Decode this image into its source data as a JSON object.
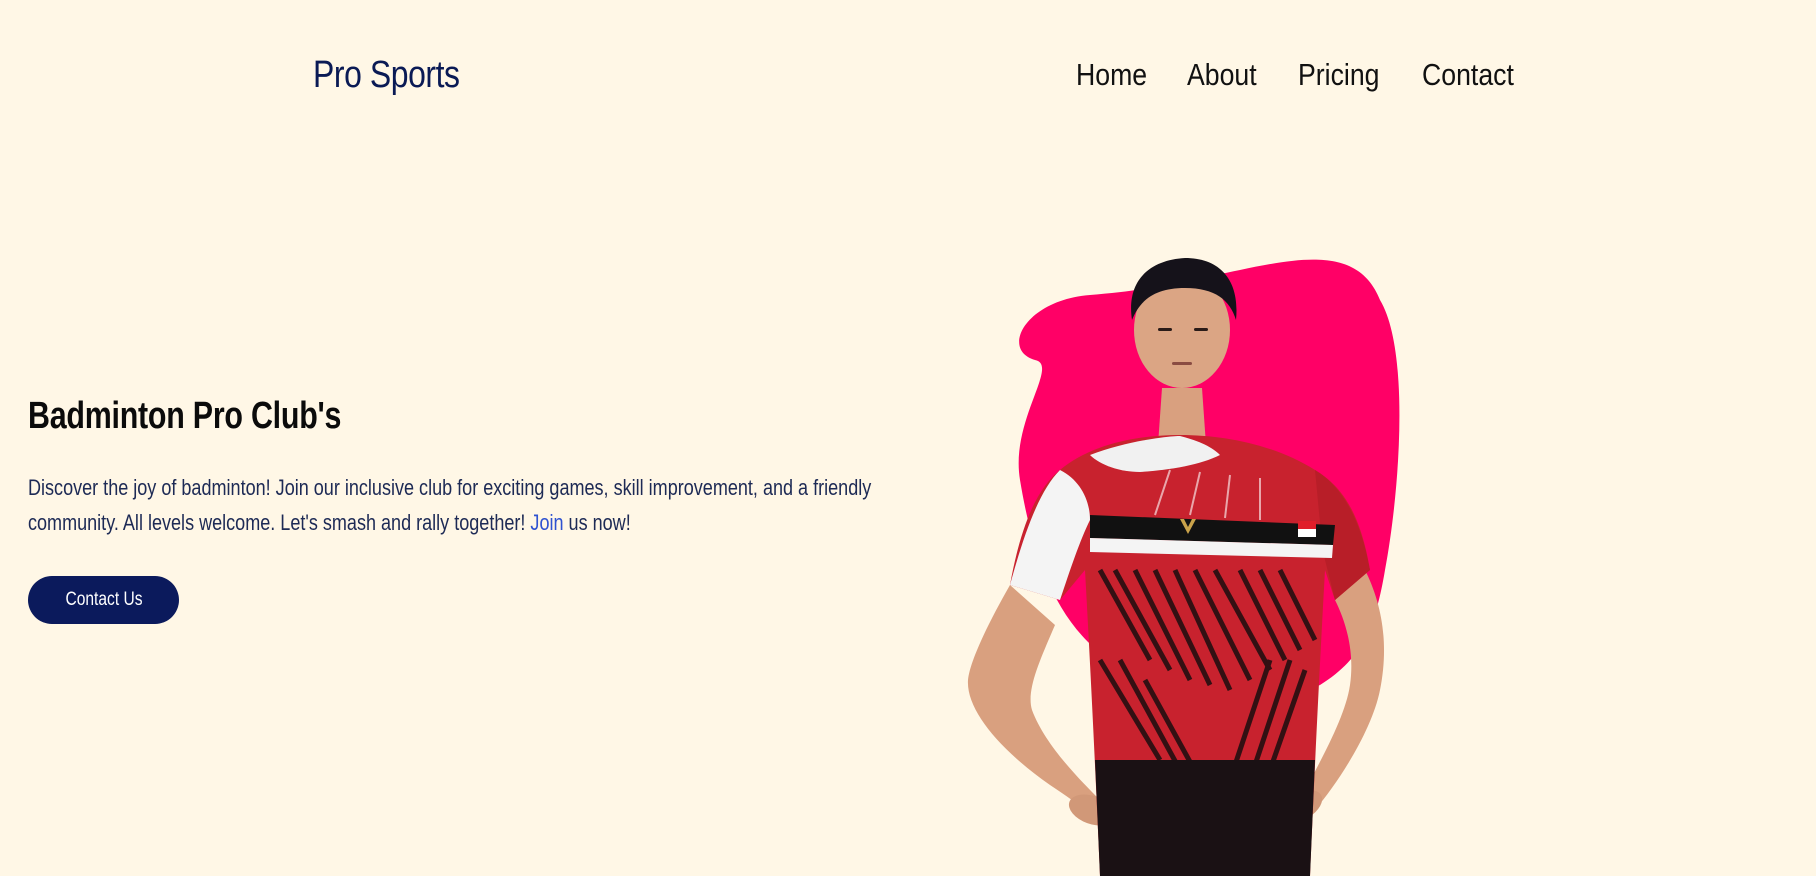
{
  "header": {
    "logo": "Pro Sports",
    "nav": {
      "home": "Home",
      "about": "About",
      "pricing": "Pricing",
      "contact": "Contact"
    }
  },
  "hero": {
    "title": "Badminton Pro Club's",
    "description_before_link": "Discover the joy of badminton! Join our inclusive club for exciting games, skill improvement, and a friendly community. All levels welcome. Let's smash and rally together! ",
    "link_text": "Join",
    "description_after_link": " us now!",
    "button_label": "Contact Us"
  },
  "colors": {
    "background": "#fff7e6",
    "brand_navy": "#0b1a5c",
    "blob_pink": "#ff0066",
    "link_blue": "#2f52d0"
  }
}
